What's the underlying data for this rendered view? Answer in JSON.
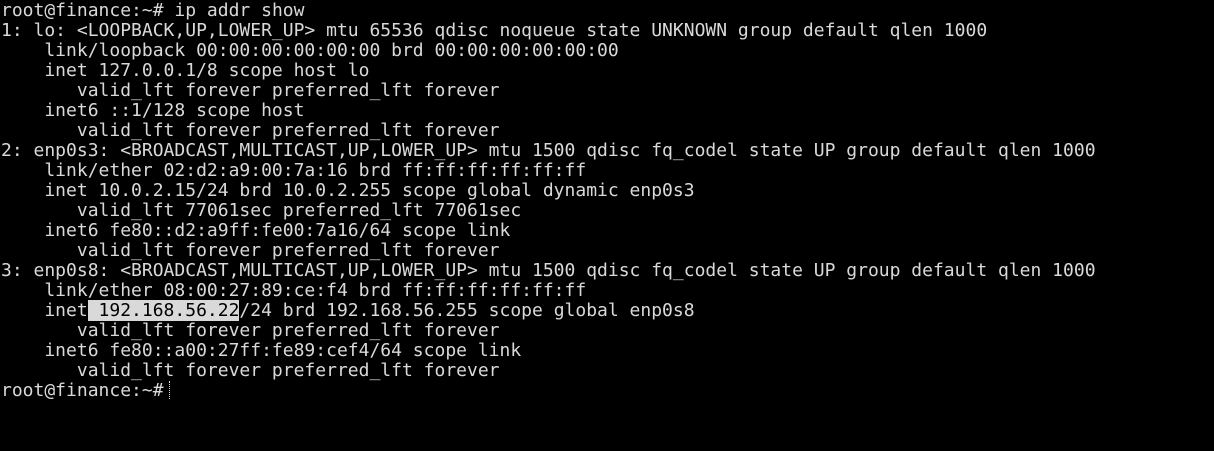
{
  "terminal": {
    "prompt": "root@finance:~#",
    "command": "ip addr show",
    "selection_color": "#d9d9d9",
    "text_color": "#d9d9d9",
    "background": "#000000",
    "lines": [
      "1: lo: <LOOPBACK,UP,LOWER_UP> mtu 65536 qdisc noqueue state UNKNOWN group default qlen 1000",
      "    link/loopback 00:00:00:00:00:00 brd 00:00:00:00:00:00",
      "    inet 127.0.0.1/8 scope host lo",
      "       valid_lft forever preferred_lft forever",
      "    inet6 ::1/128 scope host",
      "       valid_lft forever preferred_lft forever",
      "2: enp0s3: <BROADCAST,MULTICAST,UP,LOWER_UP> mtu 1500 qdisc fq_codel state UP group default qlen 1000",
      "    link/ether 02:d2:a9:00:7a:16 brd ff:ff:ff:ff:ff:ff",
      "    inet 10.0.2.15/24 brd 10.0.2.255 scope global dynamic enp0s3",
      "       valid_lft 77061sec preferred_lft 77061sec",
      "    inet6 fe80::d2:a9ff:fe00:7a16/64 scope link",
      "       valid_lft forever preferred_lft forever",
      "3: enp0s8: <BROADCAST,MULTICAST,UP,LOWER_UP> mtu 1500 qdisc fq_codel state UP group default qlen 1000",
      "    link/ether 08:00:27:89:ce:f4 brd ff:ff:ff:ff:ff:ff"
    ],
    "highlight_line": {
      "prefix": "    inet",
      "selected": " 192.168.56.22",
      "suffix": "/24 brd 192.168.56.255 scope global enp0s8"
    },
    "lines_after": [
      "       valid_lft forever preferred_lft forever",
      "    inet6 fe80::a00:27ff:fe89:cef4/64 scope link",
      "       valid_lft forever preferred_lft forever"
    ],
    "final_prompt": "root@finance:~#"
  }
}
